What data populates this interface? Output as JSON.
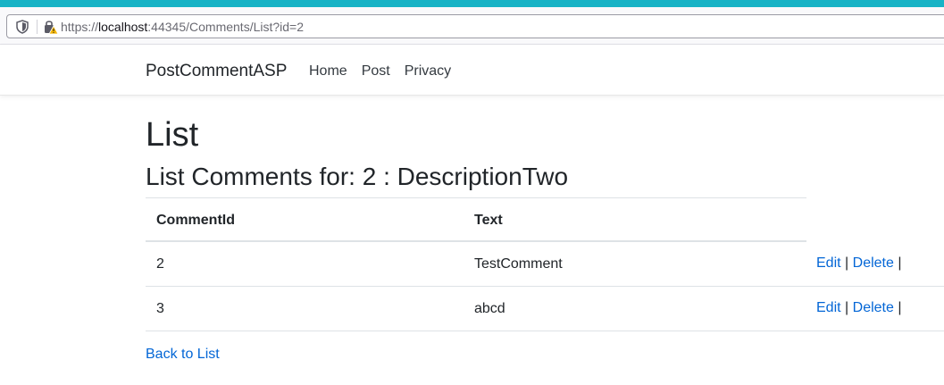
{
  "browser": {
    "url_prefix": "https://",
    "url_host": "localhost",
    "url_rest": ":44345/Comments/List?id=2"
  },
  "navbar": {
    "brand": "PostCommentASP",
    "links": [
      "Home",
      "Post",
      "Privacy"
    ]
  },
  "page": {
    "title": "List",
    "subtitle": "List Comments for: 2 : DescriptionTwo"
  },
  "table": {
    "headers": [
      "CommentId",
      "Text"
    ],
    "rows": [
      {
        "id": "2",
        "text": "TestComment",
        "edit": "Edit",
        "sep1": "|",
        "delete": "Delete",
        "sep2": "|"
      },
      {
        "id": "3",
        "text": "abcd",
        "edit": "Edit",
        "sep1": "|",
        "delete": "Delete",
        "sep2": "|"
      }
    ]
  },
  "back_link": "Back to List",
  "colors": {
    "accent_strip": "#17b3c6",
    "link": "#0366d6",
    "text": "#212529"
  }
}
